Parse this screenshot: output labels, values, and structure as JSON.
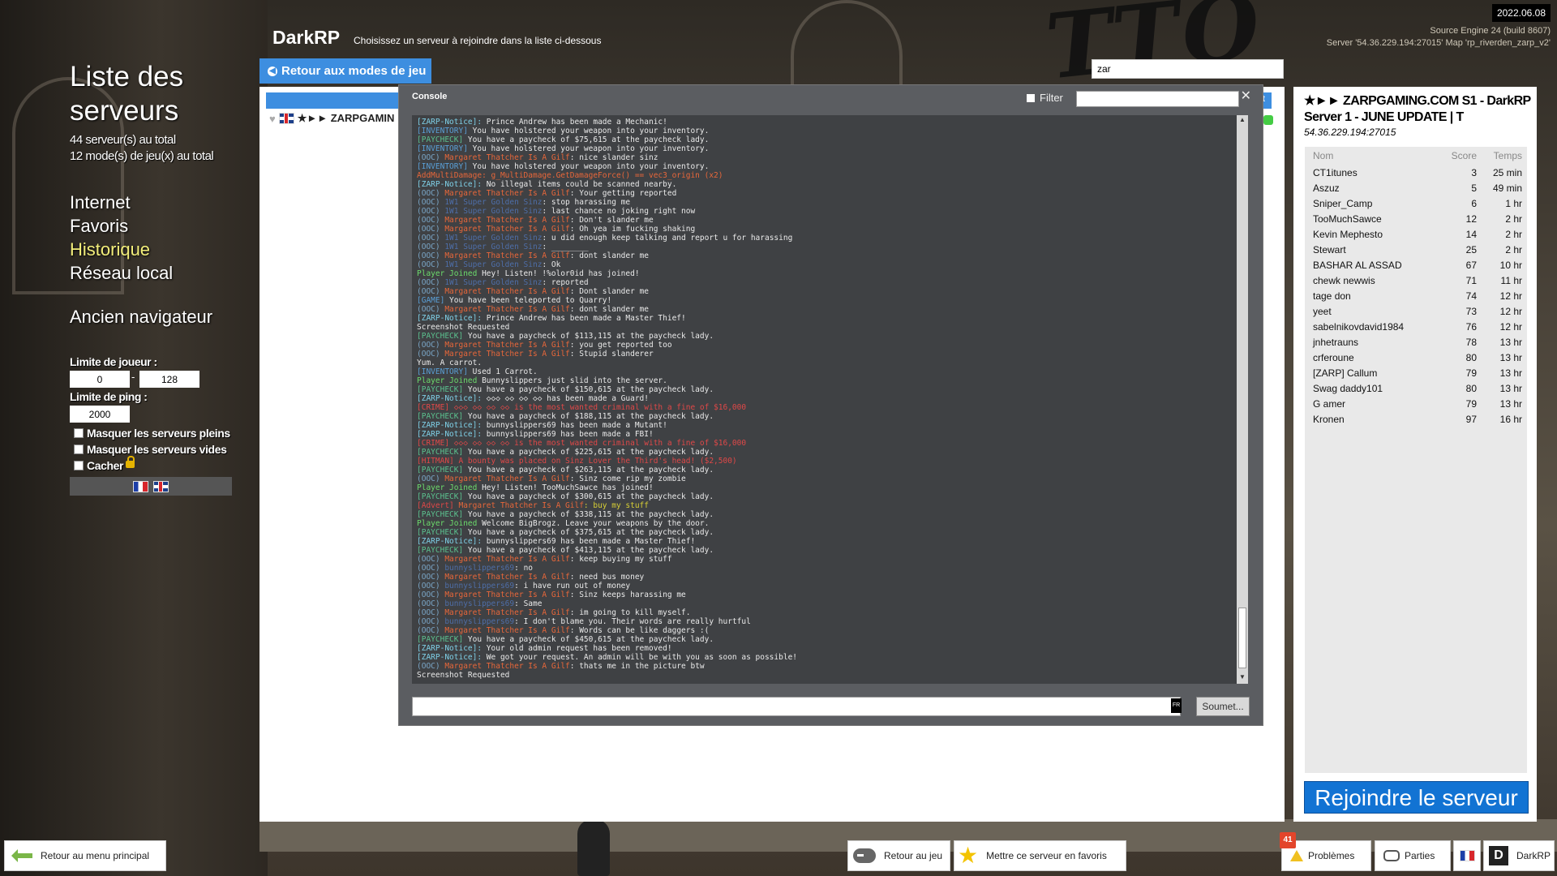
{
  "top_right": {
    "date": "2022.06.08",
    "engine": "Source Engine 24 (build 8607)",
    "server_line": "Server '54.36.229.194:27015' Map 'rp_riverden_zarp_v2'"
  },
  "header": {
    "title": "DarkRP",
    "subtitle": "Choisissez un serveur à rejoindre dans la liste ci-dessous",
    "back_label": "Retour aux modes de jeu",
    "search_value": "zar"
  },
  "left": {
    "title": "Liste des serveurs",
    "server_count": "44 serveur(s) au total",
    "mode_count": "12 mode(s) de jeu(x) au total",
    "nav": [
      {
        "label": "Internet"
      },
      {
        "label": "Favoris"
      },
      {
        "label": "Historique",
        "active": true
      },
      {
        "label": "Réseau local"
      }
    ],
    "legacy": "Ancien navigateur",
    "player_limit_label": "Limite de joueur :",
    "player_min": "0",
    "player_max": "128",
    "ping_limit_label": "Limite de ping :",
    "ping_value": "2000",
    "hide_full": "Masquer les serveurs pleins",
    "hide_empty": "Masquer les serveurs vides",
    "hide": "Cacher"
  },
  "server_list": {
    "row_name": "★►► ZARPGAMIN",
    "header_cut": "nt"
  },
  "console": {
    "title": "Console",
    "filter_label": "Filter",
    "submit_label": "Soumet...",
    "lang": "FR",
    "colors": {
      "notice": "#7fd1e8",
      "inventory": "#5a9fd6",
      "paycheck": "#5bc08e",
      "ooc": "#7aa6c7",
      "margaret": "#e8673a",
      "super": "#4e6ea8",
      "joined": "#6cdc6c",
      "red": "#e04848",
      "addmulti": "#e8673a",
      "advert": "#d8d035",
      "game": "#5a9fd6"
    },
    "lines": [
      [
        [
          "notice",
          "[ZARP-Notice]: "
        ],
        [
          "txt",
          "Prince Andrew has been made a Mechanic!"
        ]
      ],
      [
        [
          "inventory",
          "[INVENTORY] "
        ],
        [
          "txt",
          "You have holstered your weapon into your inventory."
        ]
      ],
      [
        [
          "paycheck",
          "[PAYCHECK] "
        ],
        [
          "txt",
          "You have a paycheck of $75,615 at the paycheck lady."
        ]
      ],
      [
        [
          "inventory",
          "[INVENTORY] "
        ],
        [
          "txt",
          "You have holstered your weapon into your inventory."
        ]
      ],
      [
        [
          "ooc",
          "(OOC) "
        ],
        [
          "margaret",
          "Margaret Thatcher Is A Gilf"
        ],
        [
          "txt",
          ": nice slander sinz"
        ]
      ],
      [
        [
          "inventory",
          "[INVENTORY] "
        ],
        [
          "txt",
          "You have holstered your weapon into your inventory."
        ]
      ],
      [
        [
          "addmulti",
          "AddMultiDamage: g_MultiDamage.GetDamageForce() == vec3_origin (x2)"
        ]
      ],
      [
        [
          "notice",
          "[ZARP-Notice]: "
        ],
        [
          "txt",
          "No illegal items could be scanned nearby."
        ]
      ],
      [
        [
          "ooc",
          "(OOC) "
        ],
        [
          "margaret",
          "Margaret Thatcher Is A Gilf"
        ],
        [
          "txt",
          ": Your getting reported"
        ]
      ],
      [
        [
          "ooc",
          "(OOC) "
        ],
        [
          "super",
          "1W1 Super Golden Sinz"
        ],
        [
          "txt",
          ": stop harassing me"
        ]
      ],
      [
        [
          "ooc",
          "(OOC) "
        ],
        [
          "super",
          "1W1 Super Golden Sinz"
        ],
        [
          "txt",
          ": last chance no joking right now"
        ]
      ],
      [
        [
          "ooc",
          "(OOC) "
        ],
        [
          "margaret",
          "Margaret Thatcher Is A Gilf"
        ],
        [
          "txt",
          ": Don't slander me"
        ]
      ],
      [
        [
          "ooc",
          "(OOC) "
        ],
        [
          "margaret",
          "Margaret Thatcher Is A Gilf"
        ],
        [
          "txt",
          ": Oh yea im fucking shaking"
        ]
      ],
      [
        [
          "ooc",
          "(OOC) "
        ],
        [
          "super",
          "1W1 Super Golden Sinz"
        ],
        [
          "txt",
          ": u did enough keep talking and report u for harassing"
        ]
      ],
      [
        [
          "ooc",
          "(OOC) "
        ],
        [
          "super",
          "1W1 Super Golden Sinz"
        ],
        [
          "txt",
          ": ________"
        ]
      ],
      [
        [
          "ooc",
          "(OOC) "
        ],
        [
          "margaret",
          "Margaret Thatcher Is A Gilf"
        ],
        [
          "txt",
          ": dont slander me"
        ]
      ],
      [
        [
          "ooc",
          "(OOC) "
        ],
        [
          "super",
          "1W1 Super Golden Sinz"
        ],
        [
          "txt",
          ": Ok"
        ]
      ],
      [
        [
          "joined",
          "Player Joined "
        ],
        [
          "txt",
          "Hey! Listen! !%olor0id has joined!"
        ]
      ],
      [
        [
          "ooc",
          "(OOC) "
        ],
        [
          "super",
          "1W1 Super Golden Sinz"
        ],
        [
          "txt",
          ": reported"
        ]
      ],
      [
        [
          "ooc",
          "(OOC) "
        ],
        [
          "margaret",
          "Margaret Thatcher Is A Gilf"
        ],
        [
          "txt",
          ": Dont slander me"
        ]
      ],
      [
        [
          "game",
          "[GAME] "
        ],
        [
          "txt",
          "You have been teleported to Quarry!"
        ]
      ],
      [
        [
          "ooc",
          "(OOC) "
        ],
        [
          "margaret",
          "Margaret Thatcher Is A Gilf"
        ],
        [
          "txt",
          ": dont slander me"
        ]
      ],
      [
        [
          "notice",
          "[ZARP-Notice]: "
        ],
        [
          "txt",
          "Prince Andrew has been made a Master Thief!"
        ]
      ],
      [
        [
          "txt",
          "Screenshot Requested"
        ]
      ],
      [
        [
          "paycheck",
          "[PAYCHECK] "
        ],
        [
          "txt",
          "You have a paycheck of $113,115 at the paycheck lady."
        ]
      ],
      [
        [
          "ooc",
          "(OOC) "
        ],
        [
          "margaret",
          "Margaret Thatcher Is A Gilf"
        ],
        [
          "txt",
          ": you get reported too"
        ]
      ],
      [
        [
          "ooc",
          "(OOC) "
        ],
        [
          "margaret",
          "Margaret Thatcher Is A Gilf"
        ],
        [
          "txt",
          ": Stupid slanderer"
        ]
      ],
      [
        [
          "txt",
          "Yum. A carrot."
        ]
      ],
      [
        [
          "inventory",
          "[INVENTORY] "
        ],
        [
          "txt",
          "Used 1 Carrot."
        ]
      ],
      [
        [
          "joined",
          "Player Joined "
        ],
        [
          "txt",
          "Bunnyslippers just slid into the server."
        ]
      ],
      [
        [
          "paycheck",
          "[PAYCHECK] "
        ],
        [
          "txt",
          "You have a paycheck of $150,615 at the paycheck lady."
        ]
      ],
      [
        [
          "notice",
          "[ZARP-Notice]: "
        ],
        [
          "txt",
          "◇◇◇ ◇◇ ◇◇ ◇◇ has been made a Guard!"
        ]
      ],
      [
        [
          "red",
          "[CRIME] ◇◇◇ ◇◇ ◇◇ ◇◇ is the most wanted criminal with a fine of $16,000"
        ]
      ],
      [
        [
          "paycheck",
          "[PAYCHECK] "
        ],
        [
          "txt",
          "You have a paycheck of $188,115 at the paycheck lady."
        ]
      ],
      [
        [
          "notice",
          "[ZARP-Notice]: "
        ],
        [
          "txt",
          "bunnyslippers69 has been made a Mutant!"
        ]
      ],
      [
        [
          "notice",
          "[ZARP-Notice]: "
        ],
        [
          "txt",
          "bunnyslippers69 has been made a FBI!"
        ]
      ],
      [
        [
          "red",
          "[CRIME] ◇◇◇ ◇◇ ◇◇ ◇◇ is the most wanted criminal with a fine of $16,000"
        ]
      ],
      [
        [
          "paycheck",
          "[PAYCHECK] "
        ],
        [
          "txt",
          "You have a paycheck of $225,615 at the paycheck lady."
        ]
      ],
      [
        [
          "red",
          "[HITMAN] A bounty was placed on Sinz Lover the Third's head! ($2,500)"
        ]
      ],
      [
        [
          "paycheck",
          "[PAYCHECK] "
        ],
        [
          "txt",
          "You have a paycheck of $263,115 at the paycheck lady."
        ]
      ],
      [
        [
          "ooc",
          "(OOC) "
        ],
        [
          "margaret",
          "Margaret Thatcher Is A Gilf"
        ],
        [
          "txt",
          ": Sinz come rip my zombie"
        ]
      ],
      [
        [
          "joined",
          "Player Joined "
        ],
        [
          "txt",
          "Hey! Listen! TooMuchSawce has joined!"
        ]
      ],
      [
        [
          "paycheck",
          "[PAYCHECK] "
        ],
        [
          "txt",
          "You have a paycheck of $300,615 at the paycheck lady."
        ]
      ],
      [
        [
          "red",
          "[Advert] "
        ],
        [
          "margaret",
          "Margaret Thatcher Is A Gilf"
        ],
        [
          "advert",
          ": buy my stuff"
        ]
      ],
      [
        [
          "paycheck",
          "[PAYCHECK] "
        ],
        [
          "txt",
          "You have a paycheck of $338,115 at the paycheck lady."
        ]
      ],
      [
        [
          "joined",
          "Player Joined "
        ],
        [
          "txt",
          "Welcome BigBrogz. Leave your weapons by the door."
        ]
      ],
      [
        [
          "paycheck",
          "[PAYCHECK] "
        ],
        [
          "txt",
          "You have a paycheck of $375,615 at the paycheck lady."
        ]
      ],
      [
        [
          "notice",
          "[ZARP-Notice]: "
        ],
        [
          "txt",
          "bunnyslippers69 has been made a Master Thief!"
        ]
      ],
      [
        [
          "paycheck",
          "[PAYCHECK] "
        ],
        [
          "txt",
          "You have a paycheck of $413,115 at the paycheck lady."
        ]
      ],
      [
        [
          "ooc",
          "(OOC) "
        ],
        [
          "margaret",
          "Margaret Thatcher Is A Gilf"
        ],
        [
          "txt",
          ": keep buying my stuff"
        ]
      ],
      [
        [
          "ooc",
          "(OOC) "
        ],
        [
          "super",
          "bunnyslippers69"
        ],
        [
          "txt",
          ": no"
        ]
      ],
      [
        [
          "ooc",
          "(OOC) "
        ],
        [
          "margaret",
          "Margaret Thatcher Is A Gilf"
        ],
        [
          "txt",
          ": need bus money"
        ]
      ],
      [
        [
          "ooc",
          "(OOC) "
        ],
        [
          "super",
          "bunnyslippers69"
        ],
        [
          "txt",
          ": i have run out of money"
        ]
      ],
      [
        [
          "ooc",
          "(OOC) "
        ],
        [
          "margaret",
          "Margaret Thatcher Is A Gilf"
        ],
        [
          "txt",
          ": Sinz keeps harassing me"
        ]
      ],
      [
        [
          "ooc",
          "(OOC) "
        ],
        [
          "super",
          "bunnyslippers69"
        ],
        [
          "txt",
          ": Same"
        ]
      ],
      [
        [
          "ooc",
          "(OOC) "
        ],
        [
          "margaret",
          "Margaret Thatcher Is A Gilf"
        ],
        [
          "txt",
          ": im going to kill myself."
        ]
      ],
      [
        [
          "ooc",
          "(OOC) "
        ],
        [
          "super",
          "bunnyslippers69"
        ],
        [
          "txt",
          ": I don't blame you. Their words are really hurtful"
        ]
      ],
      [
        [
          "ooc",
          "(OOC) "
        ],
        [
          "margaret",
          "Margaret Thatcher Is A Gilf"
        ],
        [
          "txt",
          ": Words can be like daggers :("
        ]
      ],
      [
        [
          "paycheck",
          "[PAYCHECK] "
        ],
        [
          "txt",
          "You have a paycheck of $450,615 at the paycheck lady."
        ]
      ],
      [
        [
          "notice",
          "[ZARP-Notice]: "
        ],
        [
          "txt",
          "Your old admin request has been removed!"
        ]
      ],
      [
        [
          "notice",
          "[ZARP-Notice]: "
        ],
        [
          "txt",
          "We got your request. An admin will be with you as soon as possible!"
        ]
      ],
      [
        [
          "ooc",
          "(OOC) "
        ],
        [
          "margaret",
          "Margaret Thatcher Is A Gilf"
        ],
        [
          "txt",
          ": thats me in the picture btw"
        ]
      ],
      [
        [
          "txt",
          "Screenshot Requested"
        ]
      ]
    ]
  },
  "server_info": {
    "name": "★►► ZARPGAMING.COM S1 - DarkRP Server 1 - JUNE UPDATE | T",
    "address": "54.36.229.194:27015",
    "columns": {
      "name": "Nom",
      "score": "Score",
      "time": "Temps"
    },
    "players": [
      {
        "name": "CT1itunes",
        "score": "3",
        "time": "25 min"
      },
      {
        "name": "Aszuz",
        "score": "5",
        "time": "49 min"
      },
      {
        "name": "Sniper_Camp",
        "score": "6",
        "time": "1 hr"
      },
      {
        "name": "TooMuchSawce",
        "score": "12",
        "time": "2 hr"
      },
      {
        "name": "Kevin Mephesto",
        "score": "14",
        "time": "2 hr"
      },
      {
        "name": "Stewart",
        "score": "25",
        "time": "2 hr"
      },
      {
        "name": "BASHAR AL ASSAD",
        "score": "67",
        "time": "10 hr"
      },
      {
        "name": "chewk newwis",
        "score": "71",
        "time": "11 hr"
      },
      {
        "name": "tage don",
        "score": "74",
        "time": "12 hr"
      },
      {
        "name": "yeet",
        "score": "73",
        "time": "12 hr"
      },
      {
        "name": "sabelnikovdavid1984",
        "score": "76",
        "time": "12 hr"
      },
      {
        "name": "jnhetrauns",
        "score": "78",
        "time": "13 hr"
      },
      {
        "name": "crferoune",
        "score": "80",
        "time": "13 hr"
      },
      {
        "name": "[ZARP] Callum",
        "score": "79",
        "time": "13 hr"
      },
      {
        "name": "Swag daddy101",
        "score": "80",
        "time": "13 hr"
      },
      {
        "name": "G amer",
        "score": "79",
        "time": "13 hr"
      },
      {
        "name": "Kronen",
        "score": "97",
        "time": "16 hr"
      }
    ],
    "join_label": "Rejoindre le serveur"
  },
  "bottom": {
    "main_menu": "Retour au menu principal",
    "resume": "Retour au jeu",
    "favorite": "Mettre ce serveur en favoris",
    "problems": "Problèmes",
    "problems_count": "41",
    "games": "Parties",
    "gamemode": "DarkRP",
    "gamemode_icon_letter": "D"
  }
}
